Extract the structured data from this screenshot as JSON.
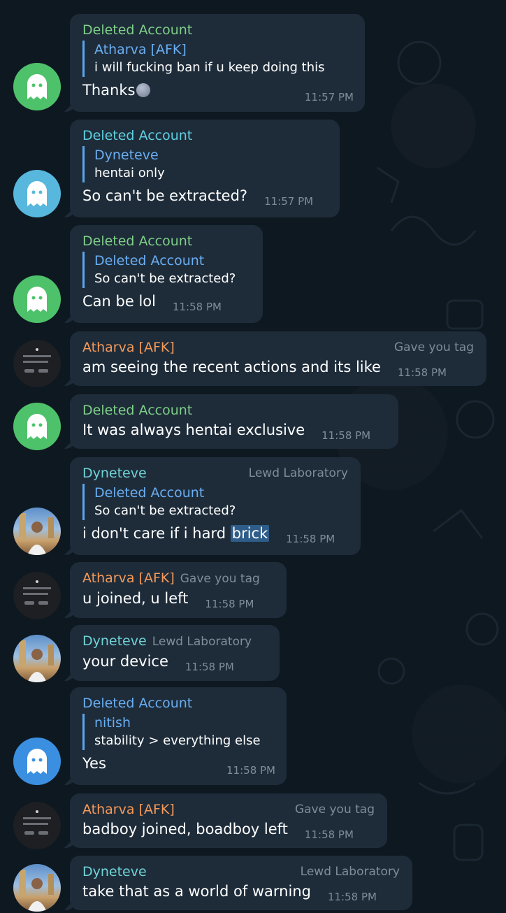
{
  "messages": [
    {
      "sender": "Deleted Account",
      "sender_color": "#7fd087",
      "reply": {
        "name": "Atharva [AFK]",
        "text": "i will fucking ban if u keep doing this"
      },
      "text": "Thanks",
      "time": "11:57 PM",
      "avatar": "ghost-green"
    },
    {
      "sender": "Deleted Account",
      "sender_color": "#5fd0e0",
      "reply": {
        "name": "Dyneteve",
        "text": "hentai only"
      },
      "text": "So can't be extracted?",
      "time": "11:57 PM",
      "avatar": "ghost-cyan"
    },
    {
      "sender": "Deleted Account",
      "sender_color": "#7fd087",
      "reply": {
        "name": "Deleted Account",
        "text": "So can't be extracted?"
      },
      "text": "Can be lol",
      "time": "11:58 PM",
      "avatar": "ghost-green"
    },
    {
      "sender": "Atharva [AFK]",
      "tag": "Gave you tag",
      "text": "am seeing the recent actions and its like",
      "time": "11:58 PM",
      "avatar": "dark"
    },
    {
      "sender": "Deleted Account",
      "text": "It was always hentai exclusive",
      "time": "11:58 PM",
      "avatar": "ghost-green"
    },
    {
      "sender": "Dyneteve",
      "tag": "Lewd Laboratory",
      "reply": {
        "name": "Deleted Account",
        "text": "So can't be extracted?"
      },
      "text_before": "i don't care if i hard ",
      "text_highlight": "brick",
      "time": "11:58 PM",
      "avatar": "photo"
    },
    {
      "sender": "Atharva [AFK]",
      "tag": "Gave you tag",
      "text": "u joined, u left",
      "time": "11:58 PM",
      "avatar": "dark"
    },
    {
      "sender": "Dyneteve",
      "tag": "Lewd Laboratory",
      "text": "your device",
      "time": "11:58 PM",
      "avatar": "photo"
    },
    {
      "sender": "Deleted Account",
      "reply": {
        "name": "nitish",
        "text": "stability > everything else"
      },
      "text": "Yes",
      "time": "11:58 PM",
      "avatar": "ghost-blue"
    },
    {
      "sender": "Atharva [AFK]",
      "tag": "Gave you tag",
      "text": "badboy joined, boadboy left",
      "time": "11:58 PM",
      "avatar": "dark"
    },
    {
      "sender": "Dyneteve",
      "tag": "Lewd Laboratory",
      "text": "take that as a world of warning",
      "time": "11:58 PM",
      "avatar": "photo"
    }
  ]
}
